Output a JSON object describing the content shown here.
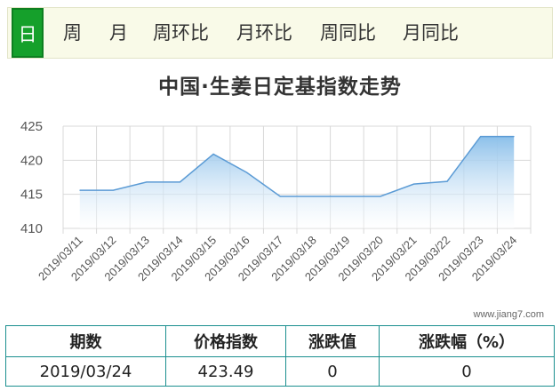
{
  "tabs": {
    "day": "日",
    "week": "周",
    "month": "月",
    "week_ring": "周环比",
    "month_ring": "月环比",
    "week_yoy": "周同比",
    "month_yoy": "月同比"
  },
  "colors": {
    "tab_active": "#15a02b",
    "line": "#5b9bd5",
    "fill_top": "#8cc0ea",
    "table_border": "#1a8f8f"
  },
  "watermark": "www.jiang7.com",
  "chart_data": {
    "type": "area",
    "title": "中国·生姜日定基指数走势",
    "x": [
      "2019/03/11",
      "2019/03/12",
      "2019/03/13",
      "2019/03/14",
      "2019/03/15",
      "2019/03/16",
      "2019/03/17",
      "2019/03/18",
      "2019/03/19",
      "2019/03/20",
      "2019/03/21",
      "2019/03/22",
      "2019/03/23",
      "2019/03/24"
    ],
    "values": [
      415.6,
      415.6,
      416.8,
      416.8,
      420.9,
      418.2,
      414.7,
      414.7,
      414.7,
      414.7,
      416.5,
      416.9,
      423.49,
      423.49
    ],
    "yticks": [
      "410",
      "415",
      "420",
      "425"
    ],
    "ylim": [
      410,
      425
    ],
    "grid": true,
    "legend": "none"
  },
  "table": {
    "headers": [
      "期数",
      "价格指数",
      "涨跌值",
      "涨跌幅（%）"
    ],
    "row": [
      "2019/03/24",
      "423.49",
      "0",
      "0"
    ]
  }
}
